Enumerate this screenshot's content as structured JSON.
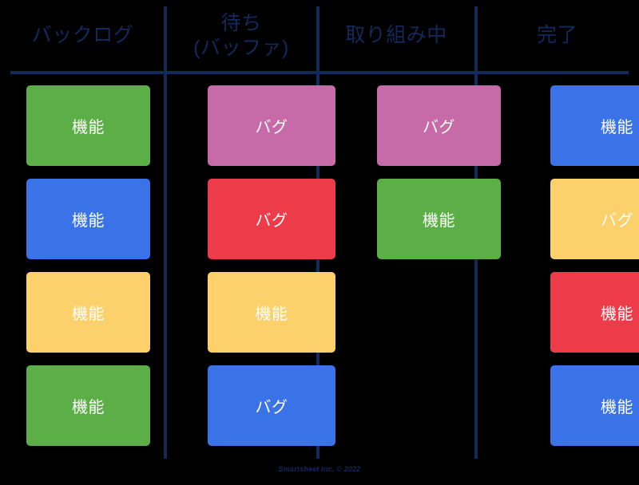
{
  "board": {
    "background_color": "#000000",
    "line_color": "#12295c",
    "card_text_color": "#ffffff",
    "palette": {
      "green": "#5caf46",
      "blue": "#3a72e8",
      "yellow": "#fcd06b",
      "pink": "#c66aa8",
      "red": "#ee3b4a"
    },
    "columns": [
      {
        "header": "バックログ",
        "cards": [
          {
            "label": "機能",
            "color": "#5caf46"
          },
          {
            "label": "機能",
            "color": "#3a72e8"
          },
          {
            "label": "機能",
            "color": "#fcd06b"
          },
          {
            "label": "機能",
            "color": "#5caf46"
          }
        ]
      },
      {
        "header": "待ち\n(バッファ)",
        "cards": [
          {
            "label": "バグ",
            "color": "#c66aa8"
          },
          {
            "label": "バグ",
            "color": "#ee3b4a"
          },
          {
            "label": "機能",
            "color": "#fcd06b"
          },
          {
            "label": "バグ",
            "color": "#3a72e8"
          }
        ]
      },
      {
        "header": "取り組み中",
        "cards": [
          {
            "label": "バグ",
            "color": "#c66aa8"
          },
          {
            "label": "機能",
            "color": "#5caf46"
          }
        ]
      },
      {
        "header": "完了",
        "cards": [
          {
            "label": "機能",
            "color": "#3a72e8"
          },
          {
            "label": "バグ",
            "color": "#fcd06b"
          },
          {
            "label": "機能",
            "color": "#ee3b4a"
          },
          {
            "label": "機能",
            "color": "#3a72e8"
          }
        ]
      }
    ]
  },
  "footer": {
    "credit": "Smartsheet Inc. © 2022"
  }
}
